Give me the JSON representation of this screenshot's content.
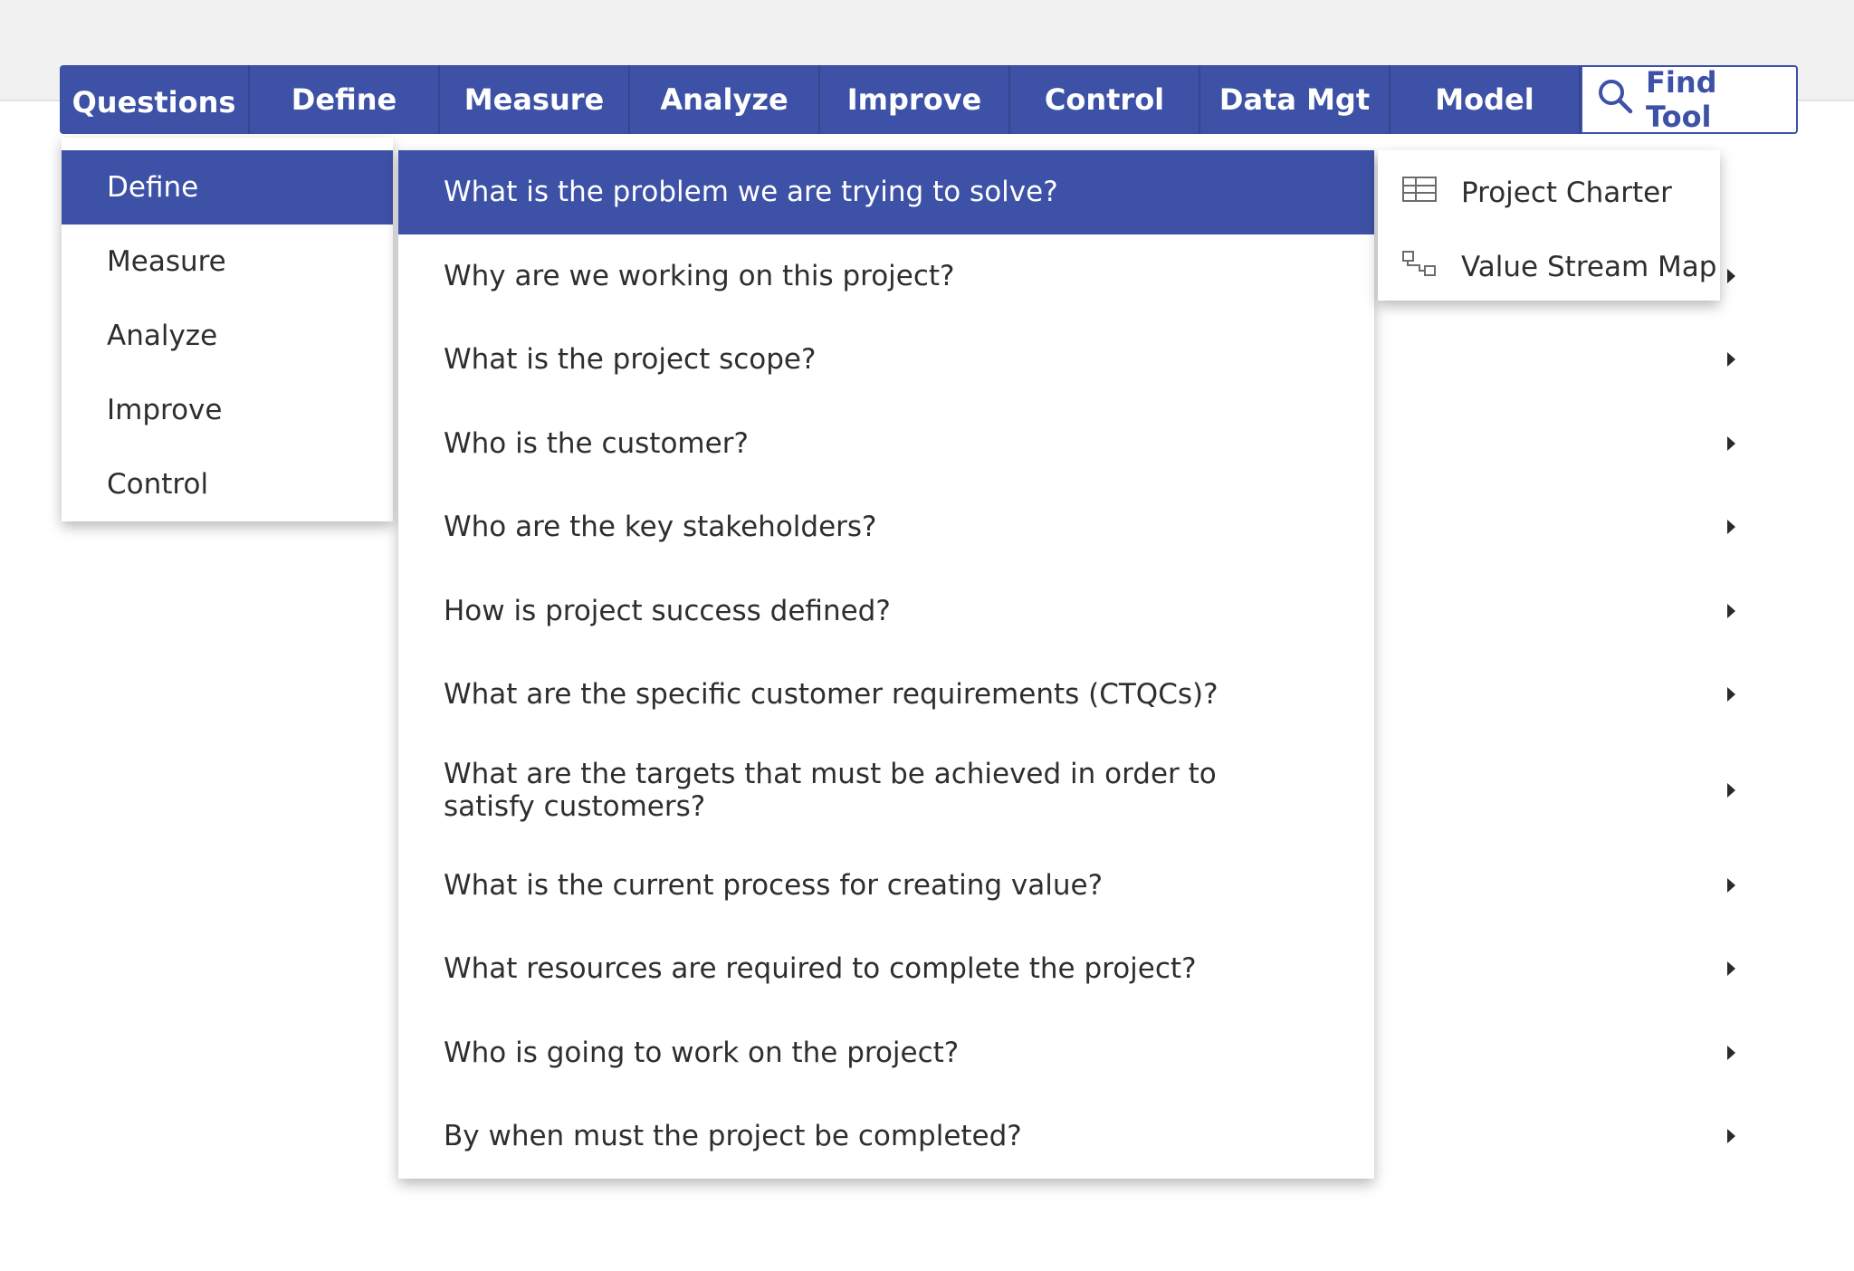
{
  "ribbon": {
    "tabs": [
      {
        "label": "Questions"
      },
      {
        "label": "Define"
      },
      {
        "label": "Measure"
      },
      {
        "label": "Analyze"
      },
      {
        "label": "Improve"
      },
      {
        "label": "Control"
      },
      {
        "label": "Data Mgt"
      },
      {
        "label": "Model"
      }
    ],
    "find_tool_label": "Find Tool"
  },
  "menu_level1": {
    "items": [
      {
        "label": "Define",
        "active": true
      },
      {
        "label": "Measure"
      },
      {
        "label": "Analyze"
      },
      {
        "label": "Improve"
      },
      {
        "label": "Control"
      }
    ]
  },
  "menu_level2": {
    "items": [
      {
        "label": "What is the problem we are trying to solve?",
        "active": true
      },
      {
        "label": "Why are we working on this project?"
      },
      {
        "label": "What is the project scope?"
      },
      {
        "label": "Who is the customer?"
      },
      {
        "label": "Who are the key stakeholders?"
      },
      {
        "label": "How is project success defined?"
      },
      {
        "label": "What are the specific customer requirements (CTQCs)?"
      },
      {
        "label": "What are the targets that must be achieved in order to satisfy customers?"
      },
      {
        "label": "What is the current process for creating value?"
      },
      {
        "label": "What resources are required to complete the project?"
      },
      {
        "label": "Who is going to work on the project?"
      },
      {
        "label": "By when must the project be completed?"
      }
    ]
  },
  "menu_level3": {
    "items": [
      {
        "label": "Project Charter",
        "icon": "table-icon"
      },
      {
        "label": "Value Stream Map",
        "icon": "value-stream-icon"
      }
    ]
  },
  "colors": {
    "accent": "#3d51a6",
    "text": "#2e2e2e"
  }
}
